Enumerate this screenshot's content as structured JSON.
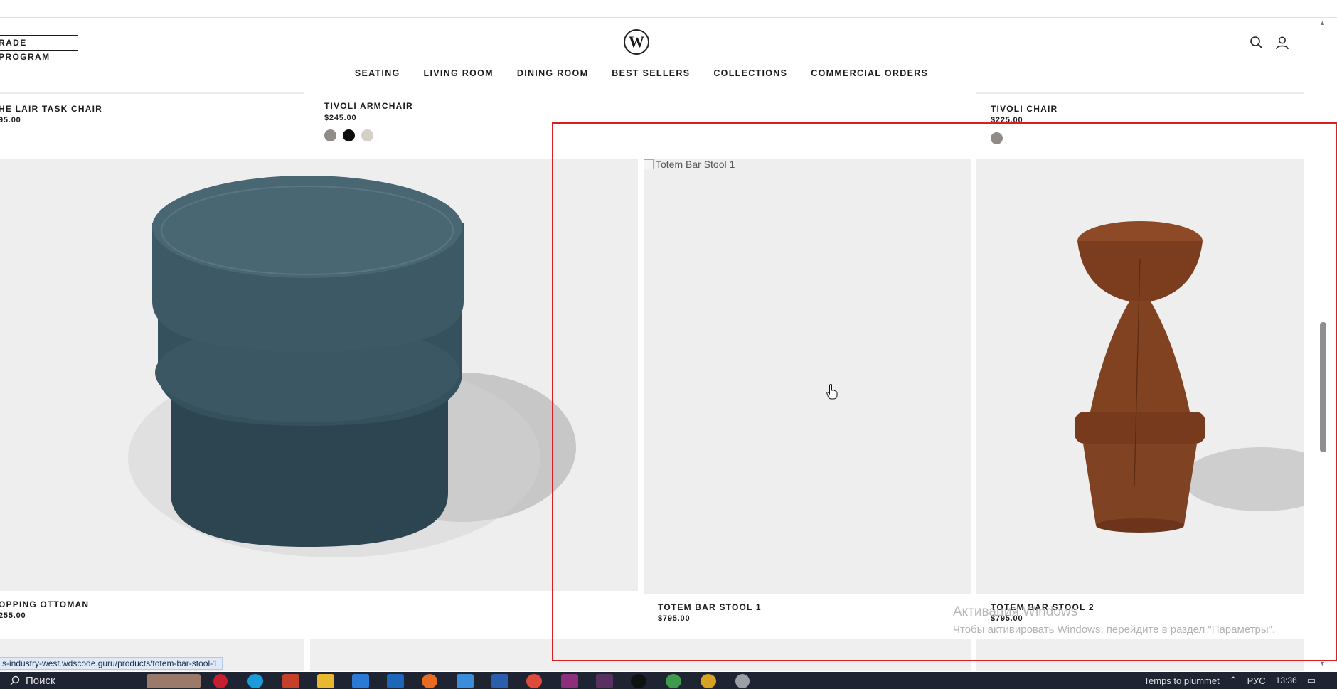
{
  "header": {
    "trade_program_label": "RADE PROGRAM",
    "logo_letter": "W",
    "nav_items": [
      "SEATING",
      "LIVING ROOM",
      "DINING ROOM",
      "BEST SELLERS",
      "COLLECTIONS",
      "COMMERCIAL ORDERS"
    ],
    "icons": [
      "search-icon",
      "account-icon"
    ]
  },
  "products_top_row": [
    {
      "name": "HE LAIR TASK CHAIR",
      "price": "95.00"
    },
    {
      "name": "TIVOLI ARMCHAIR",
      "price": "$245.00",
      "swatches": [
        "#8f8b86",
        "#0d0d0d",
        "#d6cfc7"
      ]
    },
    {
      "name": "TIVOLI CHAIR",
      "price": "$225.00",
      "swatches": [
        "#8f8b86"
      ]
    }
  ],
  "products_main_row": [
    {
      "name": "OPPING OTTOMAN",
      "price": "255.00"
    },
    {
      "name": "TOTEM BAR STOOL 1",
      "price": "$795.00",
      "image_alt": "Totem Bar Stool 1"
    },
    {
      "name": "TOTEM BAR STOOL 2",
      "price": "$795.00"
    }
  ],
  "status_bar": {
    "url": "s-industry-west.wdscode.guru/products/totem-bar-stool-1"
  },
  "watermark": {
    "line1": "Активация Windows",
    "line2": "Чтобы активировать Windows, перейдите в раздел \"Параметры\"."
  },
  "taskbar": {
    "search_label": "Поиск",
    "weather_text": "Temps to plummet",
    "language": "РУС",
    "time": "13:36",
    "apps": [
      "opera-icon",
      "edge-icon",
      "powerpoint-icon",
      "files-icon",
      "store-icon",
      "mail-icon",
      "firefox-icon",
      "app-icon",
      "word-icon",
      "chrome-icon",
      "winrar-icon",
      "slack-icon",
      "upwork-icon",
      "chrome-icon",
      "chrome-icon",
      "settings-icon"
    ]
  },
  "colors": {
    "accent_highlight": "#d91f26",
    "card_bg": "#eeeeee"
  }
}
